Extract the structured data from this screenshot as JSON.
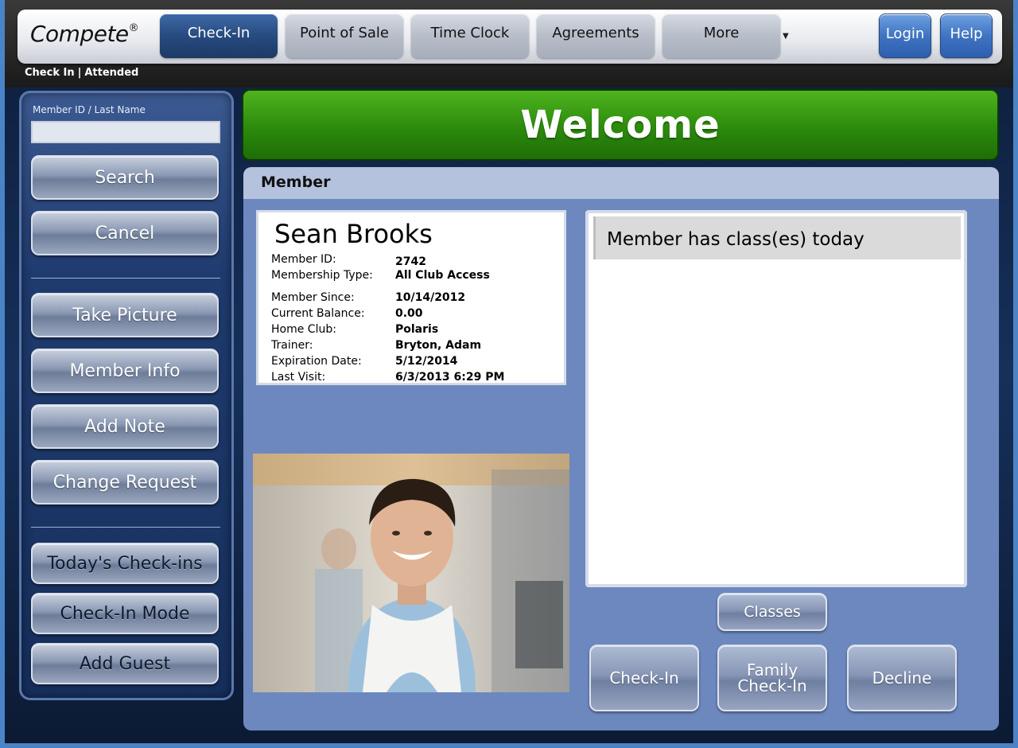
{
  "app": {
    "logo_text": "Compete",
    "logo_mark": "®"
  },
  "nav": {
    "items": [
      {
        "label": "Check-In",
        "active": true
      },
      {
        "label": "Point of Sale"
      },
      {
        "label": "Time Clock"
      },
      {
        "label": "Agreements"
      },
      {
        "label": "More"
      }
    ],
    "login_label": "Login",
    "help_label": "Help"
  },
  "breadcrumb": {
    "section": "Check In",
    "separator": "|",
    "mode": "Attended"
  },
  "sidebar": {
    "search_label": "Member ID / Last Name",
    "search_value": "",
    "buttons_top": [
      "Search",
      "Cancel"
    ],
    "buttons_mid": [
      "Take Picture",
      "Member Info",
      "Add Note",
      "Change Request"
    ],
    "buttons_bottom": [
      "Today's Check-ins",
      "Check-In Mode",
      "Add Guest"
    ]
  },
  "welcome": {
    "text": "Welcome",
    "color": "#2c8a0d"
  },
  "member": {
    "panel_title": "Member",
    "name": "Sean Brooks",
    "fields": [
      {
        "label": "Member ID:",
        "value": "2742"
      },
      {
        "label": "Membership Type:",
        "value": "All Club Access"
      },
      {
        "label": "Member Since:",
        "value": "10/14/2012"
      },
      {
        "label": "Current Balance:",
        "value": "0.00"
      },
      {
        "label": "Home Club:",
        "value": "Polaris"
      },
      {
        "label": "Trainer:",
        "value": "Bryton, Adam"
      },
      {
        "label": "Expiration Date:",
        "value": "5/12/2014"
      },
      {
        "label": "Last Visit:",
        "value": "6/3/2013 6:29 PM"
      }
    ]
  },
  "classes": {
    "message": "Member has class(es) today",
    "button_label": "Classes"
  },
  "actions": {
    "checkin_label": "Check-In",
    "family_line1": "Family",
    "family_line2": "Check-In",
    "decline_label": "Decline"
  }
}
